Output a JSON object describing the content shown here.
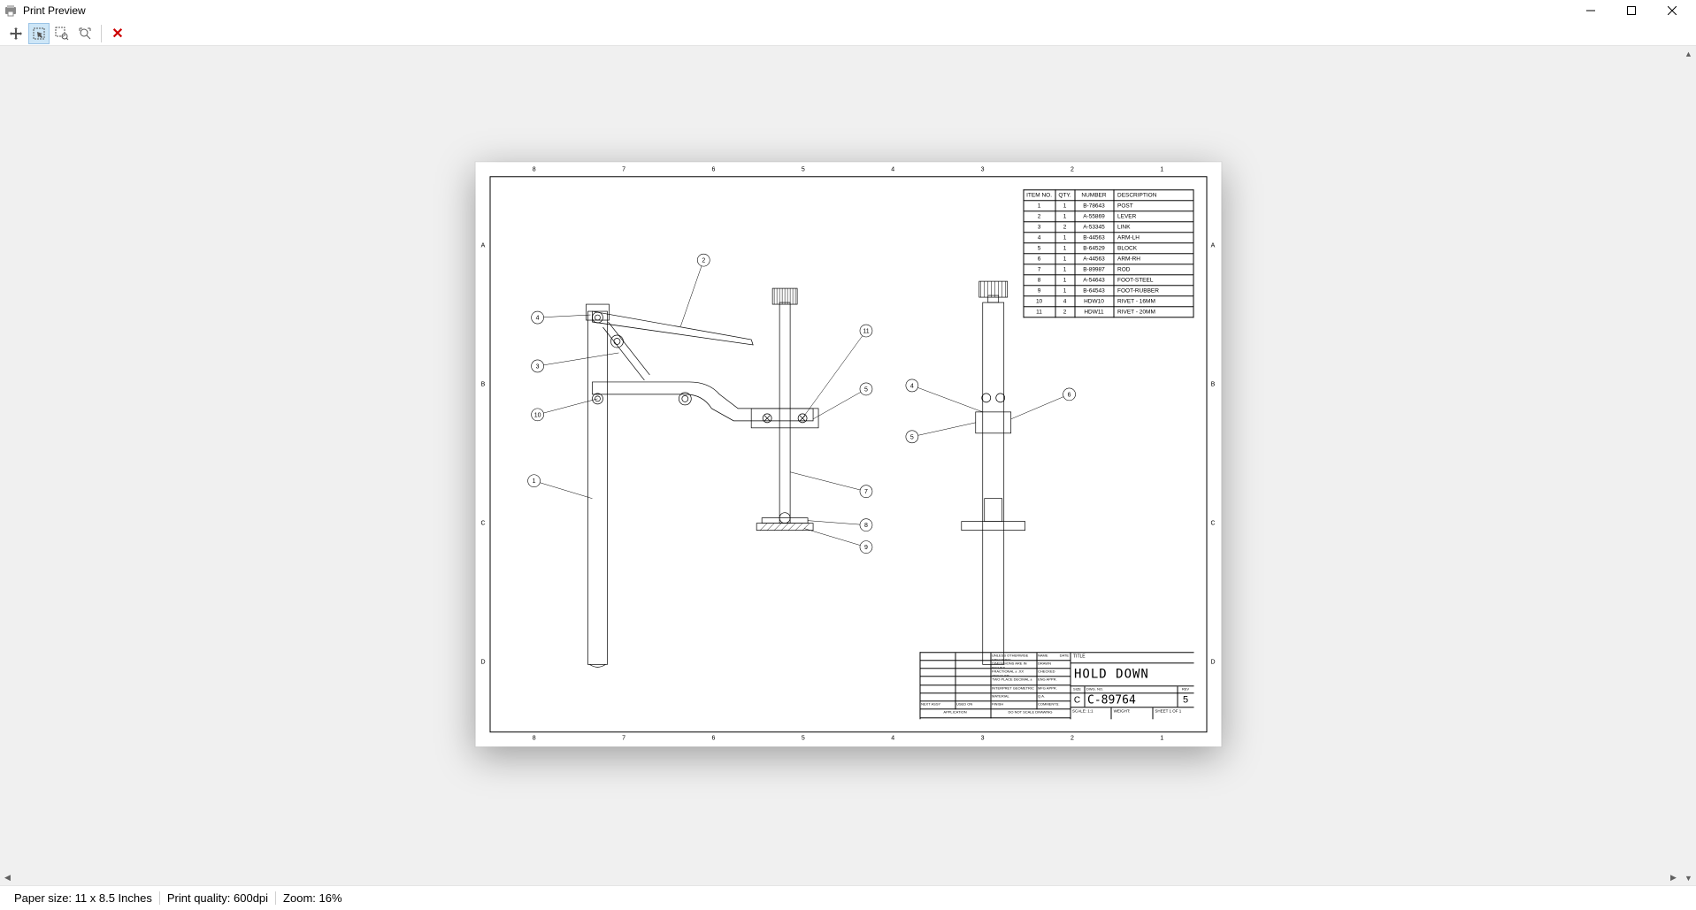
{
  "window": {
    "title": "Print Preview"
  },
  "toolbar": {
    "buttons": [
      "move",
      "select",
      "zoom-window",
      "zoom-extents",
      "close"
    ]
  },
  "ruler": {
    "top": [
      "8",
      "7",
      "6",
      "5",
      "4",
      "3",
      "2",
      "1"
    ],
    "left": [
      "A",
      "B",
      "C",
      "D"
    ]
  },
  "bom": {
    "headers": {
      "item": "ITEM\nNO.",
      "qty": "QTY.",
      "number": "NUMBER",
      "desc": "DESCRIPTION"
    },
    "rows": [
      {
        "item": "1",
        "qty": "1",
        "number": "B-78643",
        "desc": "POST"
      },
      {
        "item": "2",
        "qty": "1",
        "number": "A-55869",
        "desc": "LEVER"
      },
      {
        "item": "3",
        "qty": "2",
        "number": "A-53345",
        "desc": "LINK"
      },
      {
        "item": "4",
        "qty": "1",
        "number": "B-44563",
        "desc": "ARM-LH"
      },
      {
        "item": "5",
        "qty": "1",
        "number": "B-64529",
        "desc": "BLOCK"
      },
      {
        "item": "6",
        "qty": "1",
        "number": "A-44563",
        "desc": "ARM-RH"
      },
      {
        "item": "7",
        "qty": "1",
        "number": "B-89987",
        "desc": "ROD"
      },
      {
        "item": "8",
        "qty": "1",
        "number": "A-54643",
        "desc": "FOOT-STEEL"
      },
      {
        "item": "9",
        "qty": "1",
        "number": "B-64543",
        "desc": "FOOT-RUBBER"
      },
      {
        "item": "10",
        "qty": "4",
        "number": "HDW10",
        "desc": "RIVET - 16MM"
      },
      {
        "item": "11",
        "qty": "2",
        "number": "HDW11",
        "desc": "RIVET - 20MM"
      }
    ]
  },
  "titleblock": {
    "title_label": "TITLE",
    "title": "HOLD DOWN",
    "size_label": "SIZE",
    "size": "C",
    "dwgno_label": "DWG. NO.",
    "dwgno": "C-89764",
    "rev_label": "REV",
    "rev": "5",
    "scale_label": "SCALE: 1:1",
    "weight_label": "WEIGHT:",
    "sheet_label": "SHEET 1 OF 1",
    "notes": {
      "company": "UNLESS OTHERWISE SPECIFIED:",
      "tol1": "DIMENSIONS ARE IN INCHES",
      "tol2": "TOLERANCES:",
      "tol3": "FRACTIONAL ±    .XX    ANGULAR:",
      "tol4": "TWO PLACE DECIMAL   ±",
      "tol5": "THREE PLACE DECIMAL ±",
      "geom": "INTERPRET GEOMETRIC",
      "geom2": "TOLERANCING PER:",
      "mat": "MATERIAL",
      "fin": "FINISH",
      "app": "APPLICATION",
      "next": "NEXT ASSY",
      "used": "USED ON",
      "prop": "DO NOT SCALE DRAWING",
      "name": "NAME",
      "date": "DATE",
      "drawn": "DRAWN",
      "checked": "CHECKED",
      "enga": "ENG APPR.",
      "mfga": "MFG APPR.",
      "qa": "Q.A.",
      "comments": "COMMENTS:"
    }
  },
  "balloons": [
    "1",
    "2",
    "3",
    "4",
    "5",
    "6",
    "7",
    "8",
    "9",
    "10",
    "11"
  ],
  "status": {
    "paper": "Paper size: 11 x 8.5 Inches",
    "quality": "Print quality: 600dpi",
    "zoom": "Zoom: 16%"
  }
}
